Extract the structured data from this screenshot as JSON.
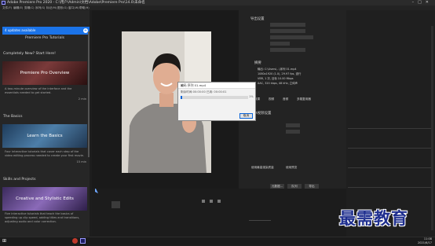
{
  "window": {
    "title": "Adobe Premiere Pro 2020 - C:\\用户\\Admin\\文档\\Adobe\\Premiere Pro\\14.0\\未命名"
  },
  "menu": [
    "文件(F)",
    "编辑(E)",
    "剪辑(C)",
    "序列(S)",
    "标记(M)",
    "图形(G)",
    "窗口(W)",
    "帮助(H)"
  ],
  "learn": {
    "updates_label": "4 updates available",
    "heading": "Premiere Pro Tutorials",
    "section1": "Completely New? Start Here!",
    "card1": {
      "title": "Premiere Pro Overview",
      "desc": "A two-minute overview of the interface and the essentials needed to get started.",
      "duration": "2 min"
    },
    "section2": "The Basics",
    "card2": {
      "title": "Learn the Basics",
      "desc": "Four interactive tutorials that cover each step of the video editing process needed to create your first movie.",
      "duration": "15 min"
    },
    "section3": "Skills and Projects",
    "card3": {
      "title": "Creative and Stylistic Edits",
      "desc": "Five interactive tutorials that teach the basics of speeding up clip speed, adding titles and transitions, adjusting audio and color correction."
    }
  },
  "export": {
    "title": "导出设置",
    "summary_label": "摘要",
    "summary_output": "输出: C:\\Users\\...\\序列 01.mp4",
    "summary_line2": "1080x1920 (1.0), 29.97 fps, 逐行",
    "summary_line3": "VBR, 1 次, 目标 10.00 Mbps",
    "summary_line4": "AAC, 320 kbps, 48 kHz, 立体声",
    "tabs": [
      "效果",
      "视频",
      "音频",
      "多路复用器"
    ],
    "basic_title": "基本视频设置",
    "use_max_quality": "使用最高渲染质量",
    "use_previews": "使用预览",
    "queue_button": "队列",
    "export_button": "导出",
    "metadata_button": "元数据..."
  },
  "dialog": {
    "title": "编码 序列 01.mp4",
    "subtitle": "剩余时间:00:00:00   已用: 00:00:01",
    "progress_label": "1%",
    "progress": 0.01,
    "cancel": "取消"
  },
  "taskbar": {
    "time": "11:08",
    "date": "2021/6/17"
  },
  "watermark": "最需教育"
}
